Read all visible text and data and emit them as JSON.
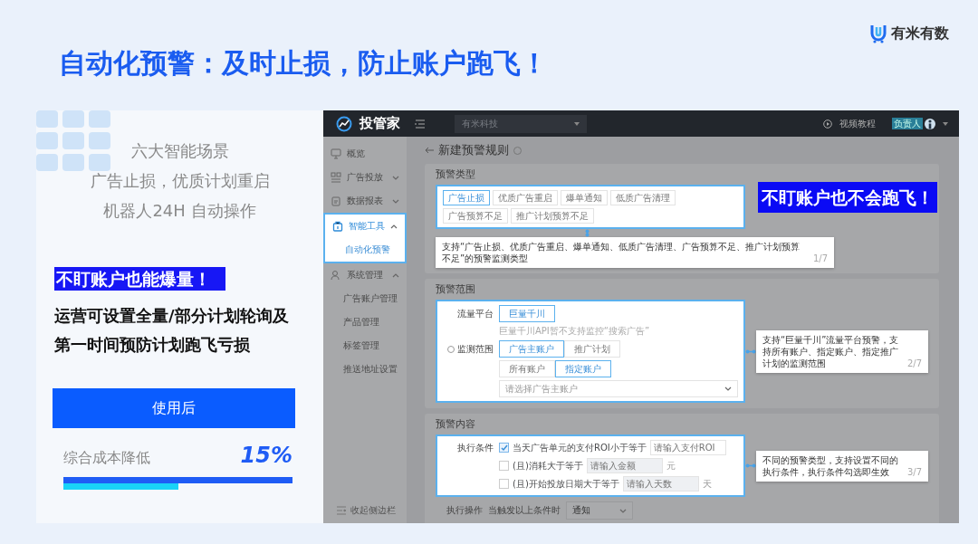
{
  "slide": {
    "title": "自动化预警：及时止损，防止账户跑飞！",
    "logo": "有米有数"
  },
  "left_card": {
    "intro_lines": [
      "六大智能场景",
      "广告止损，优质计划重启",
      "机器人24H 自动操作"
    ],
    "highlight": "不盯账户也能爆量！",
    "description_lines": [
      "运营可设置全量/部分计划轮询及",
      "第一时间预防计划跑飞亏损"
    ],
    "button": "使用后",
    "metric_label": "综合成本降低",
    "metric_value": "15%",
    "progress": {
      "level": 0.5
    }
  },
  "app": {
    "brand": "投管家",
    "org_select": "有米科技",
    "help_link": "视频教程",
    "user_badge": "负责人",
    "sidebar": {
      "items": [
        {
          "label": "概览",
          "selected": false
        },
        {
          "label": "广告投放",
          "selected": false,
          "expanded": false
        },
        {
          "label": "数据报表",
          "selected": false,
          "expanded": false
        },
        {
          "label": "智能工具",
          "selected": true,
          "expanded": true,
          "children": [
            {
              "label": "自动化预警",
              "selected": true
            }
          ]
        },
        {
          "label": "系统管理",
          "selected": false,
          "expanded": true,
          "children": [
            {
              "label": "广告账户管理",
              "selected": false
            },
            {
              "label": "产品管理",
              "selected": false
            },
            {
              "label": "标签管理",
              "selected": false
            },
            {
              "label": "推送地址设置",
              "selected": false
            }
          ]
        }
      ],
      "collapse": "收起侧边栏"
    },
    "page_title": "新建预警规则",
    "callout": "不盯账户也不会跑飞！",
    "type_section": {
      "title": "预警类型",
      "options": [
        {
          "label": "广告止损",
          "selected": true
        },
        {
          "label": "优质广告重启",
          "selected": false
        },
        {
          "label": "爆单通知",
          "selected": false
        },
        {
          "label": "低质广告清理",
          "selected": false
        },
        {
          "label": "广告预算不足",
          "selected": false
        },
        {
          "label": "推广计划预算不足",
          "selected": false
        }
      ],
      "tooltip": {
        "text": "支持“广告止损、优质广告重启、爆单通知、低质广告清理、广告预算不足、推广计划预算不足”的预警监测类型",
        "page": "1/7"
      }
    },
    "scope_section": {
      "title": "预警范围",
      "platform_label": "流量平台",
      "platform_options": [
        {
          "label": "巨量千川",
          "selected": true
        }
      ],
      "platform_note": "巨量千川API暂不支持监控“搜索广告”",
      "scope_label": "监测范围",
      "scope_options": [
        {
          "label": "广告主账户",
          "selected": true
        },
        {
          "label": "推广计划",
          "selected": false
        }
      ],
      "account_options": [
        {
          "label": "所有账户",
          "selected": false
        },
        {
          "label": "指定账户",
          "selected": true
        }
      ],
      "account_select": {
        "placeholder": "请选择广告主账户"
      },
      "tooltip": {
        "text": "支持“巨量千川”流量平台预警，支持所有账户、指定账户、指定推广计划的监测范围",
        "page": "2/7"
      }
    },
    "content_section": {
      "title": "预警内容",
      "condition_label": "执行条件",
      "conditions": [
        {
          "label": "当天广告单元的支付ROI小于等于",
          "checked": true,
          "placeholder": "请输入支付ROI"
        },
        {
          "label": "(且)消耗大于等于",
          "checked": false,
          "placeholder": "请输入金额",
          "unit": "元"
        },
        {
          "label": "(且)开始投放日期大于等于",
          "checked": false,
          "placeholder": "请输入天数",
          "unit": "天"
        }
      ],
      "tooltip": {
        "text": "不同的预警类型，支持设置不同的执行条件，执行条件勾选即生效",
        "page": "3/7"
      },
      "action_label": "执行操作",
      "action_prefix": "当触发以上条件时",
      "action_select": {
        "value": "通知"
      }
    }
  }
}
